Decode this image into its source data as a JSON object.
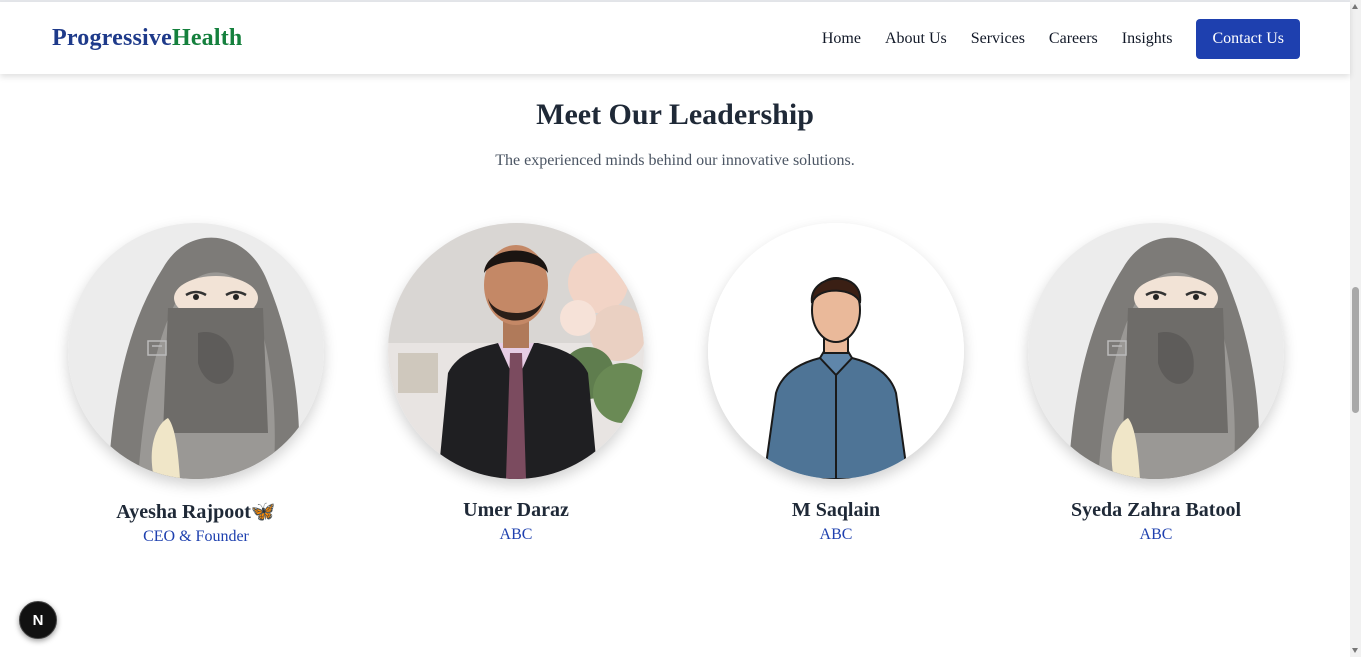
{
  "brand": {
    "part1": "Progressive",
    "part2": "Health"
  },
  "nav": {
    "links": [
      "Home",
      "About Us",
      "Services",
      "Careers",
      "Insights"
    ],
    "cta": "Contact Us"
  },
  "section": {
    "title": "Meet Our Leadership",
    "subtitle": "The experienced minds behind our innovative solutions."
  },
  "team": [
    {
      "name": "Ayesha Rajpoot🦋",
      "role": "CEO & Founder"
    },
    {
      "name": "Umer Daraz",
      "role": "ABC"
    },
    {
      "name": "M Saqlain",
      "role": "ABC"
    },
    {
      "name": "Syeda Zahra Batool",
      "role": "ABC"
    }
  ],
  "dev_badge": {
    "letter": "N"
  },
  "colors": {
    "brand_blue": "#1e3a8a",
    "brand_green": "#15803d",
    "accent": "#1e40af",
    "heading": "#1f2937"
  }
}
